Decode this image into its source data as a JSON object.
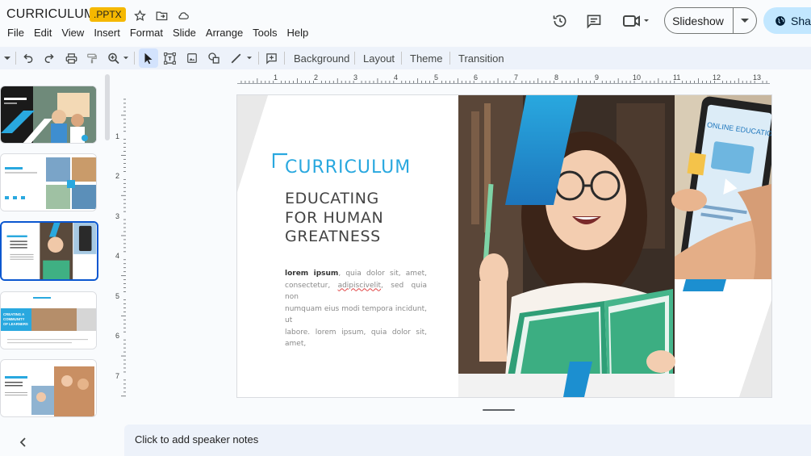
{
  "app": {
    "title": "CURRICULUM",
    "badge": ".PPTX",
    "menus": [
      "File",
      "Edit",
      "View",
      "Insert",
      "Format",
      "Slide",
      "Arrange",
      "Tools",
      "Help"
    ],
    "slideshow_label": "Slideshow",
    "share_label": "Shar"
  },
  "toolbar": {
    "background": "Background",
    "layout": "Layout",
    "theme": "Theme",
    "transition": "Transition"
  },
  "ruler": {
    "h": [
      "1",
      "2",
      "3",
      "4",
      "5",
      "6",
      "7",
      "8",
      "9",
      "10",
      "11",
      "12",
      "13"
    ],
    "v": [
      "1",
      "2",
      "3",
      "4",
      "5",
      "6",
      "7"
    ]
  },
  "slide": {
    "heading": "CURRICULUM",
    "subtitle_1": "EDUCATING",
    "subtitle_2": "FOR HUMAN",
    "subtitle_3": "GREATNESS",
    "body_bold": "lorem ipsum",
    "body_1": ", quia dolor sit, amet,",
    "body_2a": "consectetur, ",
    "body_2b": "adipiscivelit",
    "body_2c": ", sed quia non",
    "body_3": "numquam eius modi tempora incidunt, ut",
    "body_4": "labore. lorem ipsum, quia dolor sit, amet,",
    "phone_text": "ONLINE EDUCATION"
  },
  "thumbs": {
    "t4_text": "CREATING A COMMUNITY OF LEARNERS"
  },
  "notes": {
    "placeholder": "Click to add speaker notes"
  },
  "colors": {
    "accent": "#29a8df",
    "accent_dark": "#1c75bc",
    "selection": "#0b57d0",
    "badge": "#f5b800"
  }
}
